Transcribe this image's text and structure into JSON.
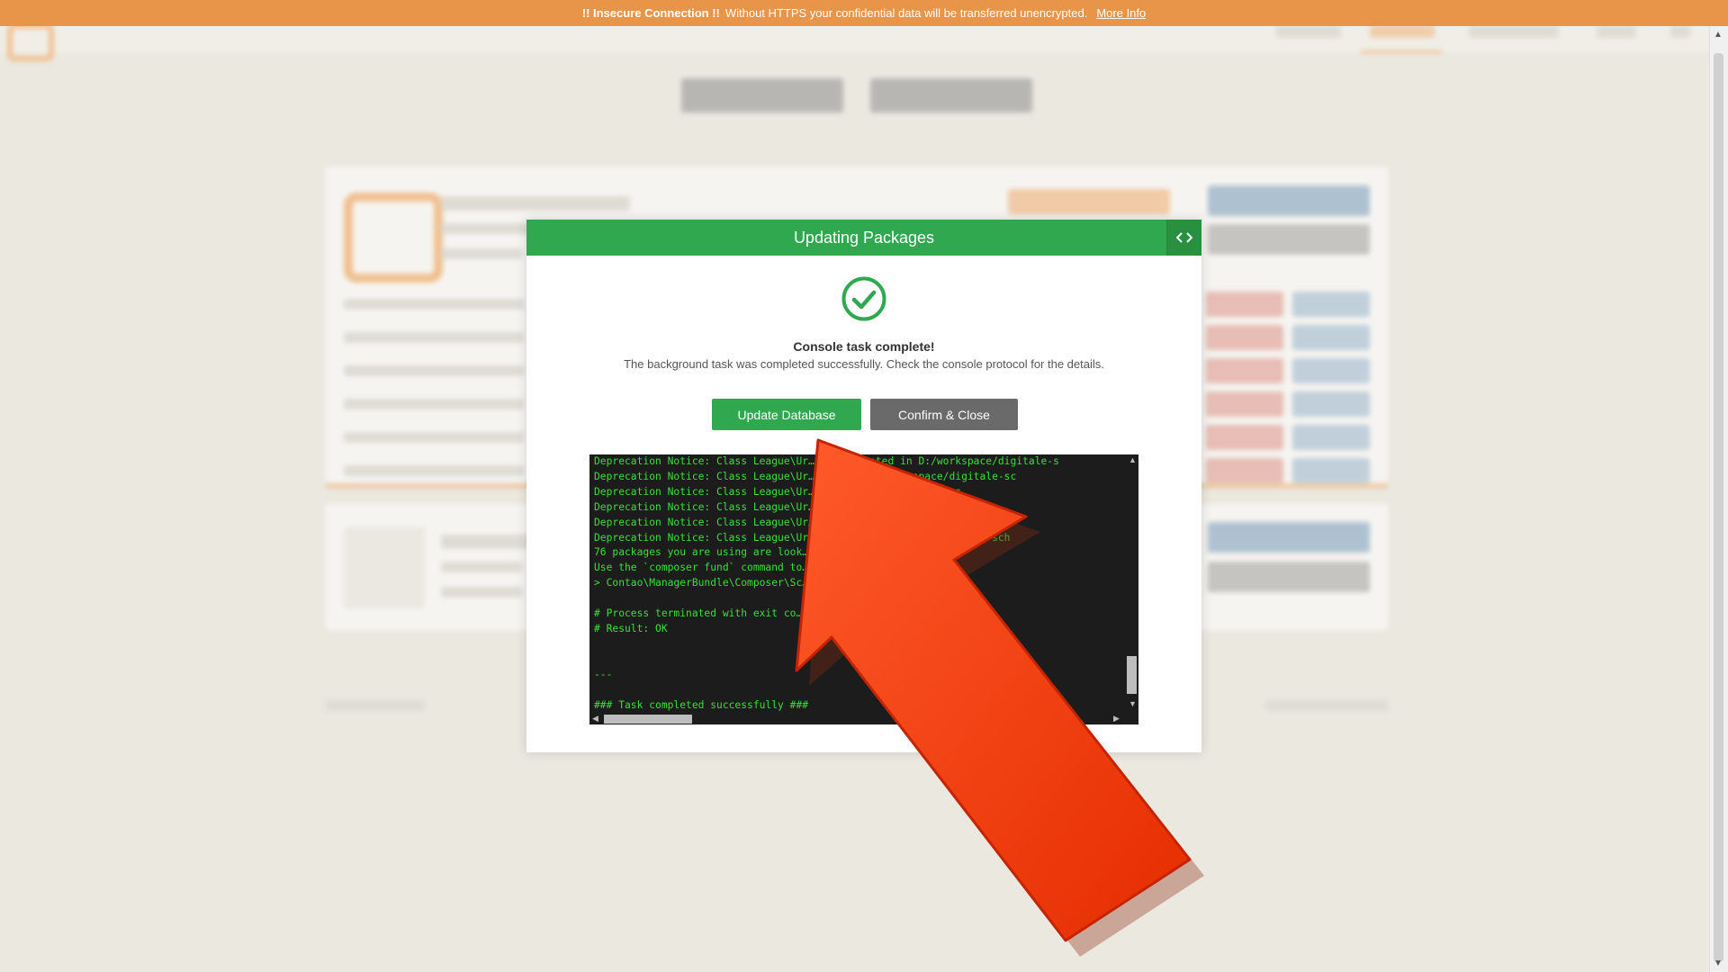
{
  "banner": {
    "title": "!! Insecure Connection !!",
    "message": "Without HTTPS your confidential data will be transferred unencrypted.",
    "link": "More Info",
    "color": "#e8954a"
  },
  "modal": {
    "title": "Updating Packages",
    "toggle_icon": "code-toggle-icon",
    "status_icon": "checkmark-circle-icon",
    "status_title": "Console task complete!",
    "status_message": "The background task was completed successfully. Check the console protocol for the details.",
    "update_database_label": "Update Database",
    "confirm_close_label": "Confirm & Close",
    "accent_color": "#2fa84f"
  },
  "console": {
    "lines": [
      "Deprecation Notice: Class League\\Ur… File located in D:/workspace/digitale-s",
      "Deprecation Notice: Class League\\Ur… ated in D:/workspace/digitale-sc",
      "Deprecation Notice: Class League\\Ur… D:/workspace/digitale-s",
      "Deprecation Notice: Class League\\Ur… D:/workspace/digitale-sc",
      "Deprecation Notice: Class League\\Ur… ated in D:/workspace/di",
      "Deprecation Notice: Class League\\Ur… ed in D:/workspace/digitale-sch",
      "76 packages you are using are look…",
      "Use the `composer fund` command to…",
      "> Contao\\ManagerBundle\\Composer\\Sc…ie… application",
      "",
      "# Process terminated with exit co…",
      "# Result: OK",
      "",
      "",
      "---",
      "",
      "### Task completed successfully ###"
    ],
    "text_color": "#38e038",
    "background": "#1c1c1c"
  }
}
